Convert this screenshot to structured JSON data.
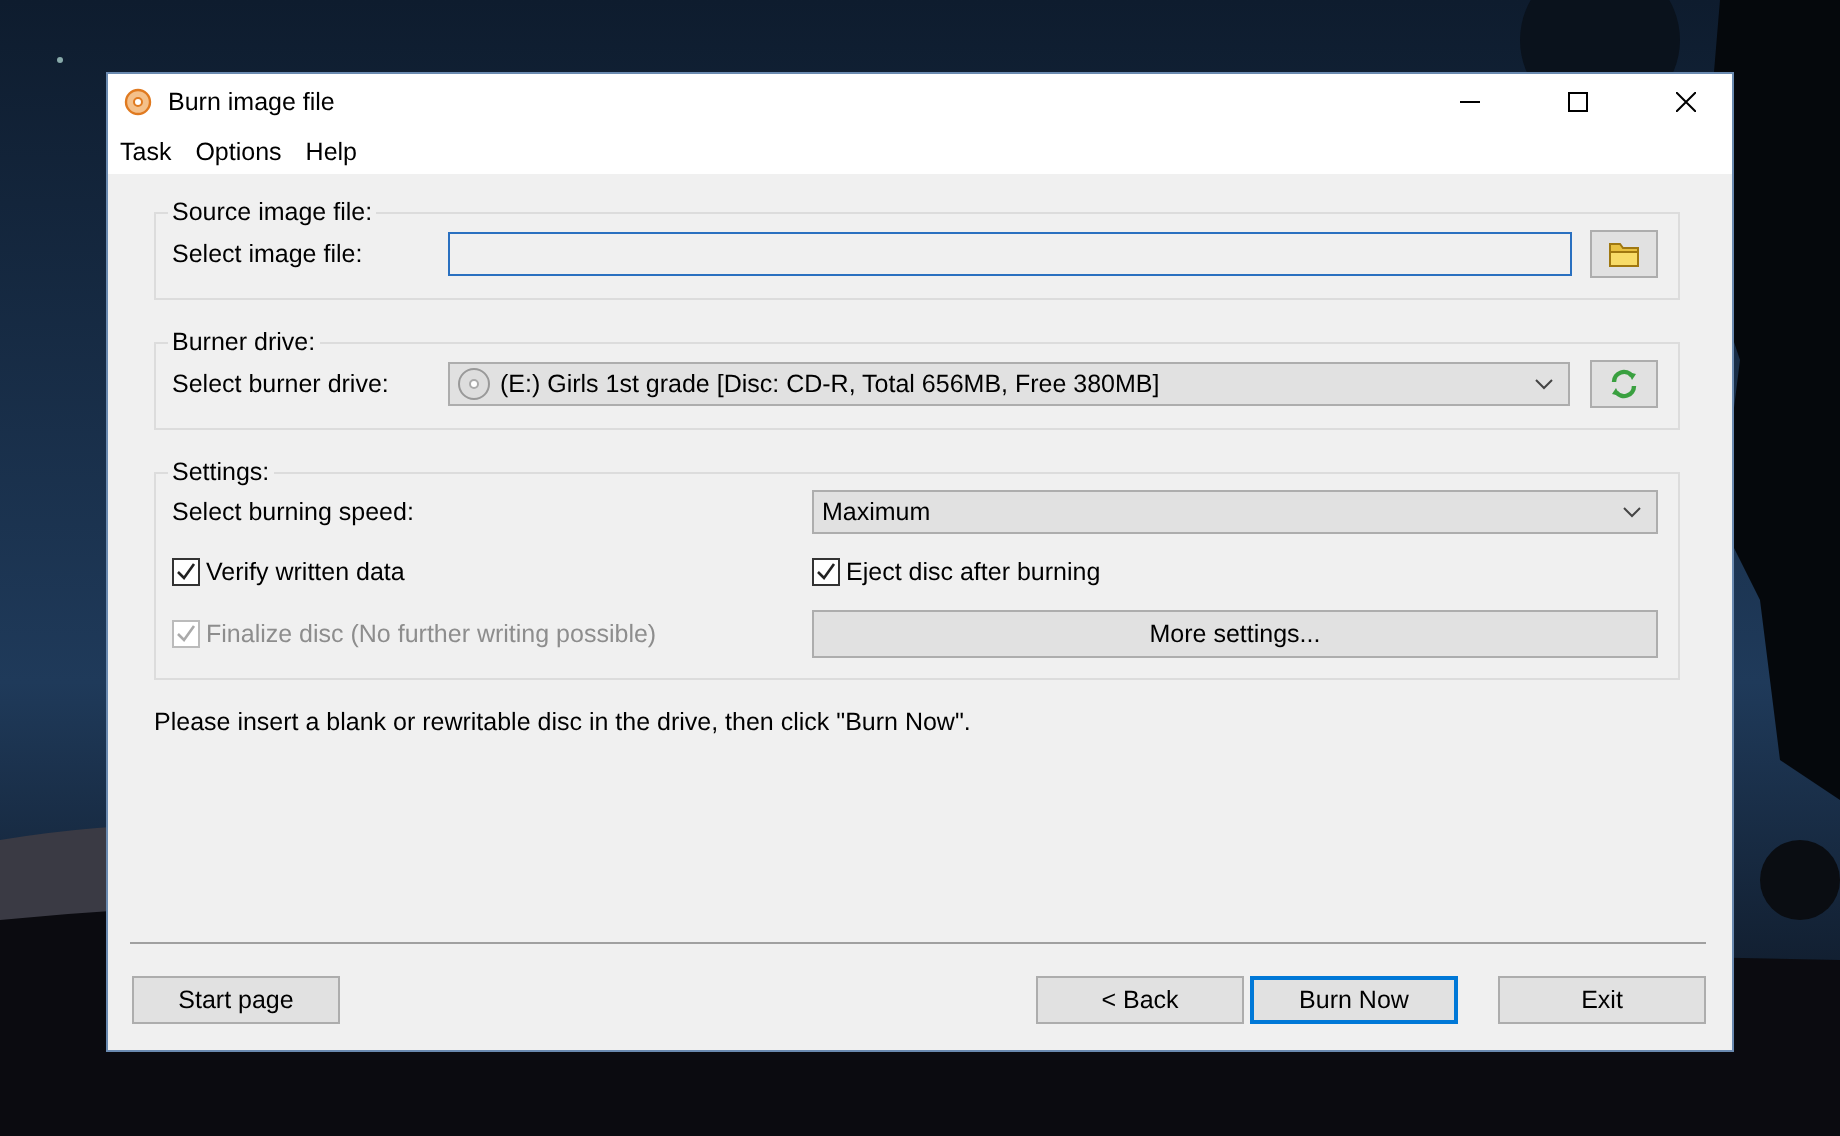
{
  "window": {
    "title": "Burn image file"
  },
  "menu": [
    "Task",
    "Options",
    "Help"
  ],
  "source": {
    "legend": "Source image file:",
    "label": "Select image file:"
  },
  "burner": {
    "legend": "Burner drive:",
    "label": "Select burner drive:",
    "drive": "(E:) Girls 1st grade [Disc: CD-R, Total 656MB, Free 380MB]"
  },
  "settings": {
    "legend": "Settings:",
    "speed_label": "Select burning speed:",
    "speed": "Maximum",
    "options": [
      {
        "label": "Verify written data",
        "checked": true,
        "disabled": false
      },
      {
        "label": "Eject disc after burning",
        "checked": true,
        "disabled": false
      },
      {
        "label": "Finalize disc (No further writing possible)",
        "checked": true,
        "disabled": true
      }
    ],
    "more_button": "More settings..."
  },
  "message": "Please insert a blank or rewritable disc in the drive, then click \"Burn Now\".",
  "footer": {
    "left": [
      {
        "label": "Start page",
        "default": false
      }
    ],
    "right": [
      {
        "label": "< Back",
        "default": false
      },
      {
        "label": "Burn Now",
        "default": true
      },
      {
        "label": "Exit",
        "default": false
      }
    ]
  }
}
